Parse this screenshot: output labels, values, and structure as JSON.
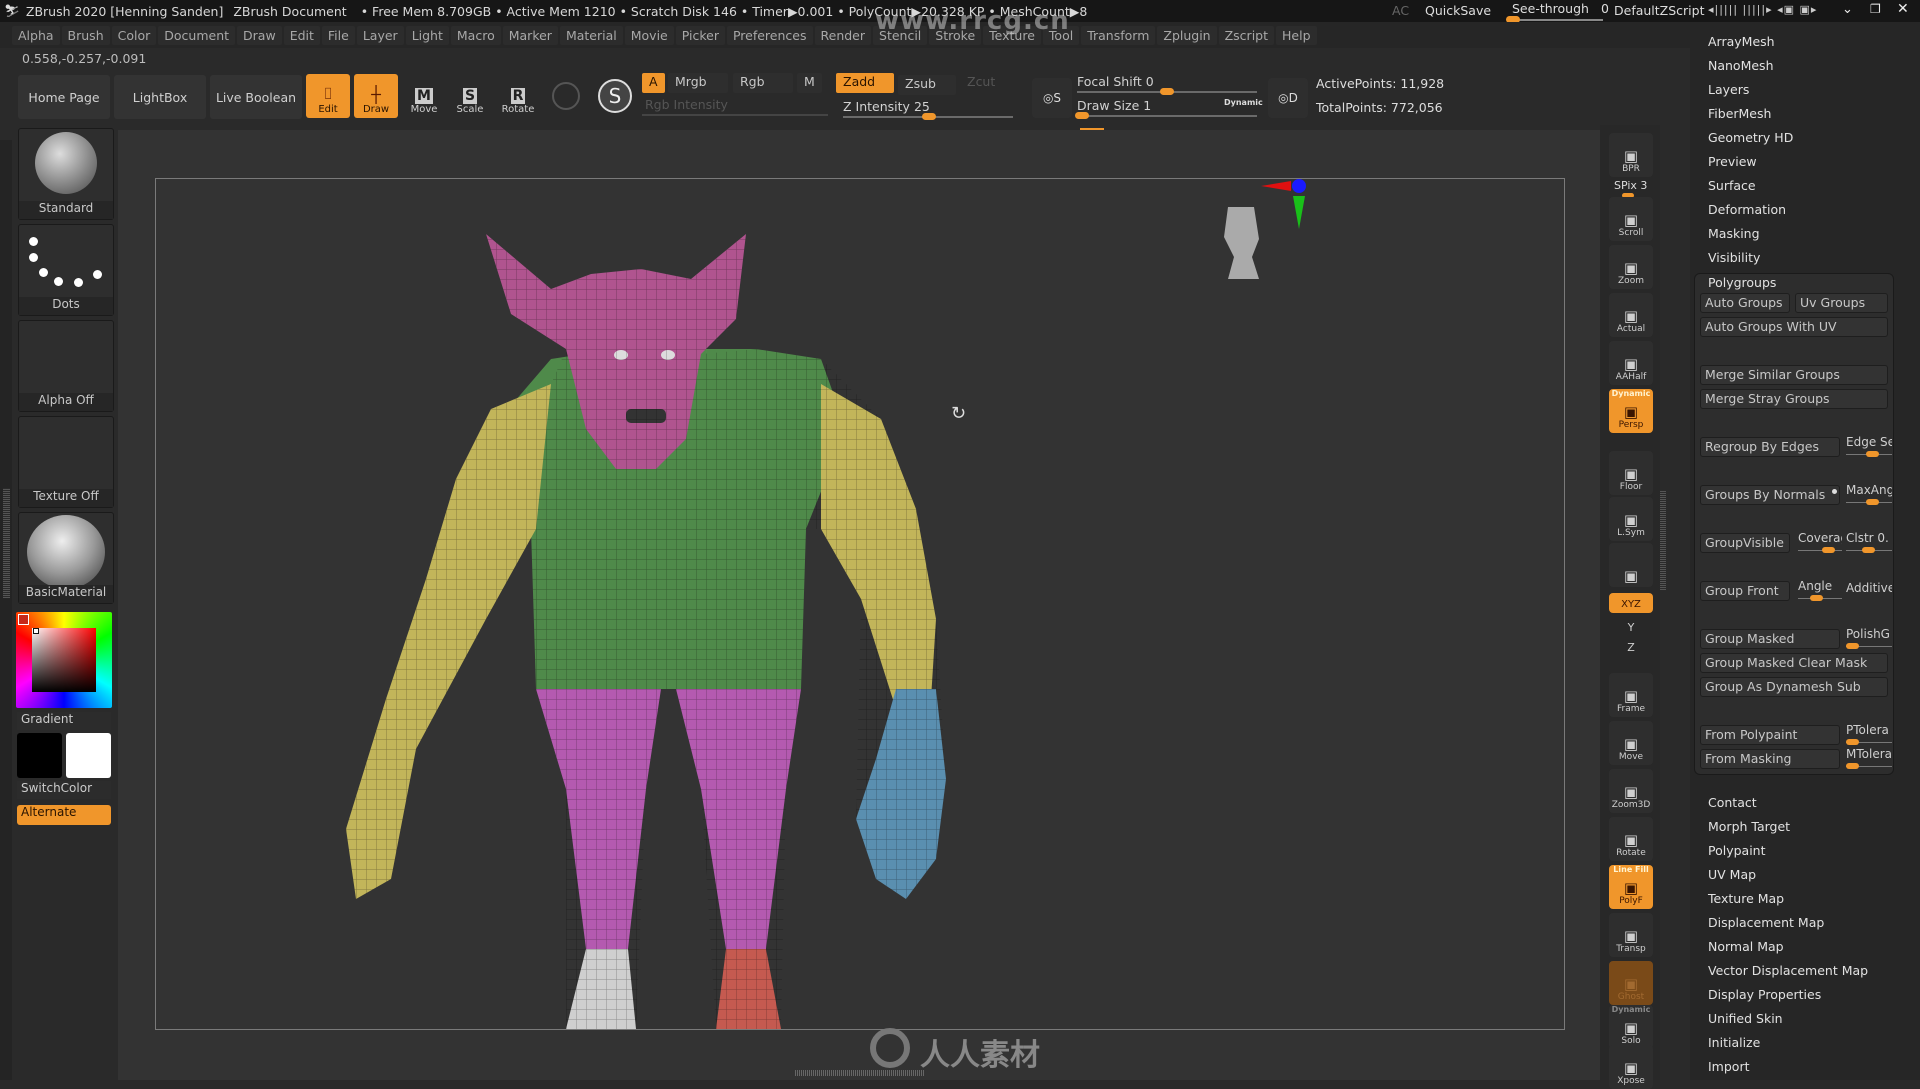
{
  "titlebar": {
    "app_title": "ZBrush 2020 [Henning Sanden]",
    "document": "ZBrush Document",
    "stats": "• Free Mem 8.709GB • Active Mem 1210 • Scratch Disk 146 • Timer▶0.001 • PolyCount▶20.328 KP • MeshCount▶8",
    "ac": "AC",
    "quicksave": "QuickSave",
    "see_through_label": "See-through",
    "see_through_value": "0",
    "see_through_fraction": 0,
    "default_zscript": "DefaultZScript",
    "window_buttons": [
      "minimize-icon",
      "restore-icon",
      "close-icon"
    ]
  },
  "menus": [
    "Alpha",
    "Brush",
    "Color",
    "Document",
    "Draw",
    "Edit",
    "File",
    "Layer",
    "Light",
    "Macro",
    "Marker",
    "Material",
    "Movie",
    "Picker",
    "Preferences",
    "Render",
    "Stencil",
    "Stroke",
    "Texture",
    "Tool",
    "Transform",
    "Zplugin",
    "Zscript",
    "Help"
  ],
  "coordinates": "0.558,-0.257,-0.091",
  "toolbar": {
    "home_page": "Home Page",
    "lightbox": "LightBox",
    "live_boolean": "Live Boolean",
    "edit": "Edit",
    "draw": "Draw",
    "move": "Move",
    "scale": "Scale",
    "rotate": "Rotate",
    "a": "A",
    "mrgb": "Mrgb",
    "rgb": "Rgb",
    "m": "M",
    "zadd": "Zadd",
    "zsub": "Zsub",
    "zcut": "Zcut",
    "rgb_intensity": "Rgb Intensity",
    "z_intensity_label": "Z Intensity",
    "z_intensity_value": "25",
    "focal_shift_label": "Focal Shift",
    "focal_shift_value": "0",
    "draw_size_label": "Draw Size",
    "draw_size_value": "1",
    "dynamic": "Dynamic",
    "s_label": "S",
    "d_label": "D",
    "active_points": "ActivePoints: 11,928",
    "total_points": "TotalPoints: 772,056"
  },
  "left_shelf": {
    "brush": "Standard",
    "stroke": "Dots",
    "alpha": "Alpha Off",
    "texture": "Texture Off",
    "material": "BasicMaterial",
    "gradient": "Gradient",
    "switch_color": "SwitchColor",
    "alternate": "Alternate",
    "main_color": "#000000",
    "secondary_color": "#ffffff"
  },
  "right_shelf": [
    {
      "label": "BPR",
      "icon": "bpr-sphere-icon",
      "active": false
    },
    {
      "label": "SPix 3",
      "icon": "spix-slider",
      "active": false
    },
    {
      "label": "Scroll",
      "icon": "hand-scroll-icon",
      "active": false
    },
    {
      "label": "Zoom",
      "icon": "zoom-icon",
      "active": false
    },
    {
      "label": "Actual",
      "icon": "actual-size-icon",
      "active": false
    },
    {
      "label": "AAHalf",
      "icon": "aahalf-icon",
      "active": false
    },
    {
      "label": "Persp",
      "sublabel": "Dynamic",
      "icon": "perspective-grid-icon",
      "active": true
    },
    {
      "label": "Floor",
      "icon": "floor-icon",
      "active": false
    },
    {
      "label": "L.Sym",
      "icon": "local-symmetry-icon",
      "active": false
    },
    {
      "label": "",
      "icon": "camera-lock-icon",
      "active": false
    },
    {
      "label": "XYZ",
      "icon": "rotate-xyz-icon",
      "active": true
    },
    {
      "label": "Y",
      "icon": "rotate-y-icon",
      "active": false
    },
    {
      "label": "Z",
      "icon": "rotate-z-icon",
      "active": false
    },
    {
      "label": "Frame",
      "icon": "frame-icon",
      "active": false
    },
    {
      "label": "Move",
      "icon": "move-3d-icon",
      "active": false
    },
    {
      "label": "Zoom3D",
      "icon": "zoom-3d-icon",
      "active": false
    },
    {
      "label": "Rotate",
      "icon": "rotate-3d-icon",
      "active": false
    },
    {
      "label": "PolyF",
      "sublabel": "Line Fill",
      "icon": "polyframe-icon",
      "active": true
    },
    {
      "label": "Transp",
      "icon": "transparency-icon",
      "active": false
    },
    {
      "label": "Ghost",
      "icon": "ghost-icon",
      "active": false
    },
    {
      "label": "Solo",
      "sublabel": "Dynamic",
      "icon": "solo-icon",
      "active": false
    },
    {
      "label": "Xpose",
      "icon": "xpose-icon",
      "active": false
    }
  ],
  "tool_panel": {
    "sections_top": [
      "ArrayMesh",
      "NanoMesh",
      "Layers",
      "FiberMesh",
      "Geometry HD",
      "Preview",
      "Surface",
      "Deformation",
      "Masking",
      "Visibility"
    ],
    "polygroups": {
      "title": "Polygroups",
      "auto_groups": "Auto Groups",
      "uv_groups": "Uv Groups",
      "auto_groups_with_uv": "Auto Groups With UV",
      "merge_similar": "Merge Similar Groups",
      "merge_stray": "Merge Stray Groups",
      "regroup_by_edges": "Regroup By Edges",
      "edge_se": "Edge Se",
      "groups_by_normals": "Groups By Normals",
      "max_ang": "MaxAng",
      "group_visible": "GroupVisible",
      "coverage": "Coverag",
      "clstr": "Clstr 0.",
      "group_front": "Group Front",
      "angle": "Angle",
      "additive": "Additive",
      "group_masked": "Group Masked",
      "polish_g": "PolishG",
      "group_masked_clear": "Group Masked Clear Mask",
      "group_dynamesh_sub": "Group As Dynamesh Sub",
      "from_polypaint": "From Polypaint",
      "ptolera": "PTolera",
      "from_masking": "From Masking",
      "mtolera": "MTolera"
    },
    "sections_bottom": [
      "Contact",
      "Morph Target",
      "Polypaint",
      "UV Map",
      "Texture Map",
      "Displacement Map",
      "Normal Map",
      "Vector Displacement Map",
      "Display Properties",
      "Unified Skin",
      "Initialize",
      "Import"
    ]
  },
  "viewport": {
    "model": "creature-polygroups",
    "polygroup_colors": {
      "head": "#b0548f",
      "torso": "#4f8a4a",
      "arms": "#c2b55a",
      "legs": "#b45ab0",
      "hand": "#5a8fb0",
      "foot_left": "#c8c8c8",
      "foot_right": "#c55a50"
    }
  },
  "watermark": {
    "site": "www.rrcg.cn",
    "brand": "人人素材",
    "tile": "RRCG 人人素材"
  }
}
